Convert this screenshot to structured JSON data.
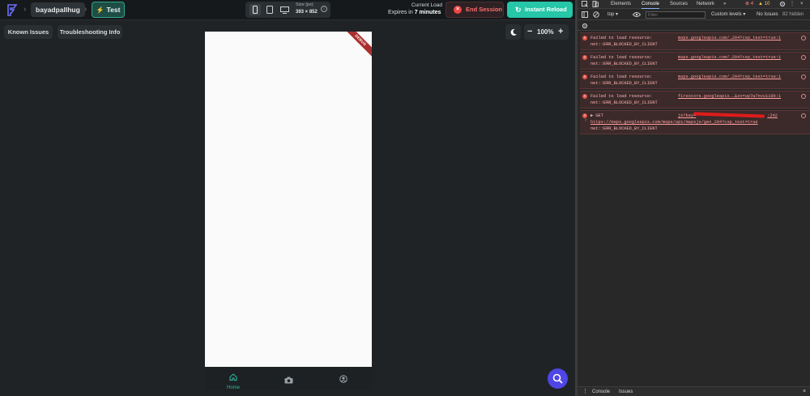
{
  "topbar": {
    "project_name": "bayadpallhug",
    "breadcrumb_sep": "›",
    "test_label": "Test",
    "size_label": "Size (px)",
    "size_value": "393 × 852",
    "load_title": "Current Load",
    "expires_prefix": "Expires in ",
    "expires_value": "7 minutes",
    "end_session_label": "End Session",
    "instant_reload_label": "Instant Reload",
    "colors": {
      "accent": "#26c6a8",
      "danger": "#ef4444",
      "chip_border": "#2fa58d"
    }
  },
  "toolbar": {
    "known_issues_label": "Known Issues",
    "troubleshooting_label": "Troubleshooting Info",
    "zoom_value": "100%",
    "zoom_minus": "−",
    "zoom_plus": "+"
  },
  "phone": {
    "debug_banner": "DEBUG",
    "nav": [
      {
        "label": "Home",
        "icon": "home-icon"
      },
      {
        "label": "",
        "icon": "camera-icon"
      },
      {
        "label": "",
        "icon": "account-icon"
      }
    ]
  },
  "devtools": {
    "tabs": [
      "Elements",
      "Console",
      "Sources",
      "Network"
    ],
    "active_tab": "Console",
    "more_tabs": "»",
    "error_count": "4",
    "warning_count": "10",
    "context": "top ▾",
    "filter_placeholder": "Filter",
    "custom_levels": "Custom levels ▾",
    "no_issues": "No Issues",
    "hidden_count": "82 hidden",
    "logs": [
      {
        "message": "Failed to load resource:",
        "net": "net::ERR_BLOCKED_BY_CLIENT",
        "source": "maps.googleapis.com/…204?csp_test=true:1"
      },
      {
        "message": "Failed to load resource:",
        "net": "net::ERR_BLOCKED_BY_CLIENT",
        "source": "maps.googleapis.com/…204?csp_test=true:1"
      },
      {
        "message": "Failed to load resource:",
        "net": "net::ERR_BLOCKED_BY_CLIENT",
        "source": "maps.googleapis.com/…204?csp_test=true:1"
      },
      {
        "message": "Failed to load resource:",
        "net": "net::ERR_BLOCKED_BY_CLIENT",
        "source": "firestore.googleapis.…&zx=up7w7nvu119b:1"
      },
      {
        "message": "▶ GET",
        "source_prefix": "js?key=",
        "source_suffix": ":242",
        "url": "https://maps.googleapis.com/maps/api/mapsjs/gen_204?csp_test=true",
        "net": "net::ERR_BLOCKED_BY_CLIENT"
      }
    ],
    "prompt": "›",
    "drawer_tabs": [
      "Console",
      "Issues"
    ],
    "drawer_menu": "⋮",
    "drawer_close": "×"
  }
}
